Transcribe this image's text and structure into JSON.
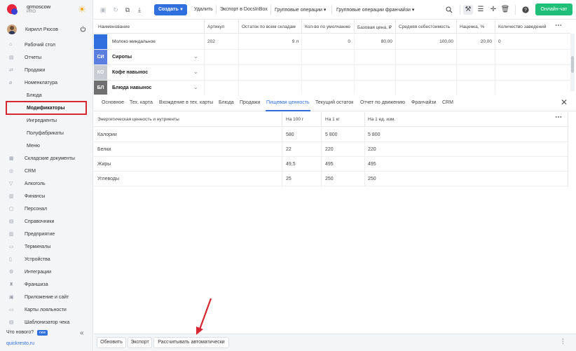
{
  "brand": {
    "name": "qrmoscow",
    "plan": "PRO"
  },
  "user": {
    "name": "Кирилл Рюсов"
  },
  "sidebar": {
    "items": [
      {
        "label": "Рабочий стол",
        "icon": "dashboard-icon"
      },
      {
        "label": "Отчеты",
        "icon": "reports-icon"
      },
      {
        "label": "Продажи",
        "icon": "sales-icon"
      },
      {
        "label": "Номенклатура",
        "icon": "nomenclature-icon"
      },
      {
        "label": "Блюда",
        "sub": true
      },
      {
        "label": "Модификаторы",
        "sub": true,
        "active": true
      },
      {
        "label": "Ингредиенты",
        "sub": true
      },
      {
        "label": "Полуфабрикаты",
        "sub": true
      },
      {
        "label": "Меню",
        "sub": true
      },
      {
        "label": "Складские документы",
        "icon": "warehouse-icon"
      },
      {
        "label": "CRM",
        "icon": "crm-icon"
      },
      {
        "label": "Алкоголь",
        "icon": "alcohol-icon"
      },
      {
        "label": "Финансы",
        "icon": "finance-icon"
      },
      {
        "label": "Персонал",
        "icon": "staff-icon"
      },
      {
        "label": "Справочники",
        "icon": "directory-icon"
      },
      {
        "label": "Предприятие",
        "icon": "enterprise-icon"
      },
      {
        "label": "Терминалы",
        "icon": "terminal-icon"
      },
      {
        "label": "Устройства",
        "icon": "devices-icon"
      },
      {
        "label": "Интеграции",
        "icon": "integrations-icon"
      },
      {
        "label": "Франшиза",
        "icon": "franchise-icon"
      },
      {
        "label": "Приложение и сайт",
        "icon": "app-icon"
      },
      {
        "label": "Карты лояльности",
        "icon": "loyalty-icon"
      },
      {
        "label": "Шаблонизатор чека",
        "icon": "receipt-icon"
      }
    ],
    "whatsnew": "Что нового?",
    "new_badge": "new",
    "site_link": "quickresto.ru"
  },
  "toolbar": {
    "create_label": "Создать",
    "links": [
      "Удалить",
      "Экспорт в DocsInBox",
      "Групповые операции",
      "Групповые операции франчайзи"
    ],
    "chat_label": "Онлайн-чат"
  },
  "grid": {
    "headers": [
      "Наименование",
      "Артикул",
      "Остаток по всем складам",
      "Кол-во по умолчанию",
      "Базовая цена, ₽",
      "Средняя себестоимость",
      "Наценка, %",
      "Количество заведений"
    ],
    "first_row": {
      "name": "Молоко миндальное",
      "article": "202",
      "stock": "9 л",
      "default_qty": "0",
      "base_price": "80,00",
      "avg_cost": "100,00",
      "markup": "20,00",
      "venues": "0"
    },
    "groups": [
      {
        "tag": "СИ",
        "name": "Сиропы",
        "color": "#5b7fe0"
      },
      {
        "tag": "КО",
        "name": "Кофе навынос",
        "color": "#c9cdd3"
      },
      {
        "tag": "БЛ",
        "name": "Блюда навынос",
        "color": "#6f6f6f"
      }
    ]
  },
  "tabs": [
    "Основное",
    "Тех. карта",
    "Вхождение в тех. карты",
    "Блюда",
    "Продажи",
    "Пищевая ценность",
    "Текущий остаток",
    "Отчет по движению",
    "Франчайзи",
    "CRM"
  ],
  "active_tab": "Пищевая ценность",
  "nutrition": {
    "headers": [
      "Энергетическая ценность и нутриенты",
      "На 100 г",
      "На 1 кг",
      "На 1 ед. изм."
    ],
    "rows": [
      {
        "name": "Калории",
        "per100": "580",
        "per1kg": "5 800",
        "perunit": "5 800"
      },
      {
        "name": "Белки",
        "per100": "22",
        "per1kg": "220",
        "perunit": "220"
      },
      {
        "name": "Жиры",
        "per100": "49,5",
        "per1kg": "495",
        "perunit": "495"
      },
      {
        "name": "Углеводы",
        "per100": "25",
        "per1kg": "250",
        "perunit": "250"
      }
    ]
  },
  "bottom": {
    "refresh": "Обновить",
    "export": "Экспорт",
    "auto_calc": "Рассчитывать автоматически"
  },
  "colors": {
    "accent": "#2f6fde",
    "chat": "#1fbf7a",
    "highlight": "#d7262f"
  }
}
